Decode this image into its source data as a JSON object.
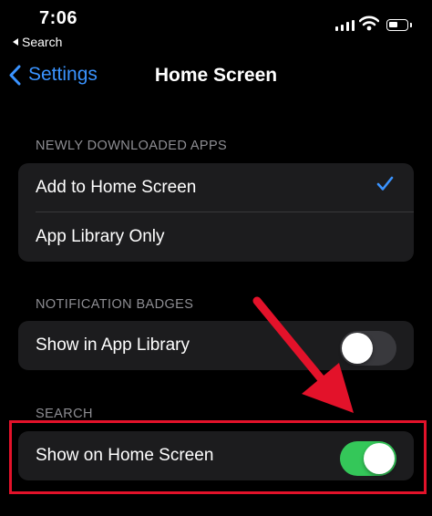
{
  "status_bar": {
    "time": "7:06",
    "back_app": "Search",
    "icons": [
      "signal-icon",
      "wifi-icon",
      "battery-icon"
    ]
  },
  "nav": {
    "back_label": "Settings",
    "title": "Home Screen"
  },
  "sections": {
    "newly_downloaded": {
      "header": "NEWLY DOWNLOADED APPS",
      "options": [
        {
          "label": "Add to Home Screen",
          "selected": true
        },
        {
          "label": "App Library Only",
          "selected": false
        }
      ]
    },
    "notification_badges": {
      "header": "NOTIFICATION BADGES",
      "row_label": "Show in App Library",
      "toggle_on": false
    },
    "search": {
      "header": "SEARCH",
      "row_label": "Show on Home Screen",
      "toggle_on": true
    }
  },
  "colors": {
    "accent": "#3a93ff",
    "toggle_on": "#34c759",
    "annotation_red": "#e3122a"
  }
}
